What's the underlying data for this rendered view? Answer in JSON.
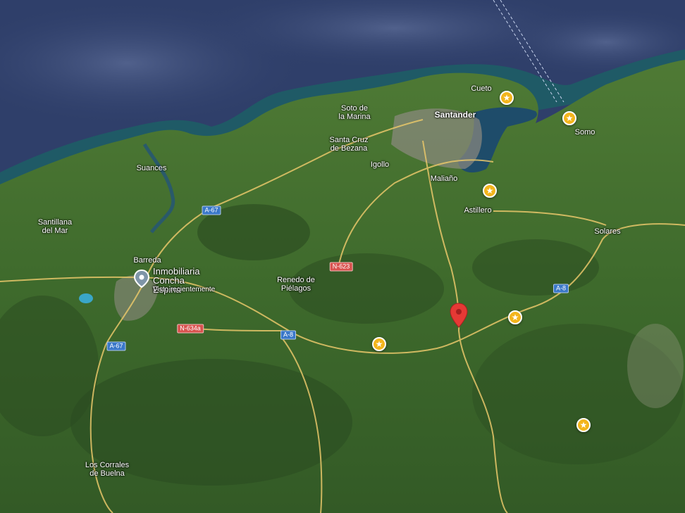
{
  "map": {
    "type": "satellite",
    "colors": {
      "sea": "#2f3f6a",
      "land": "#3d6a2c",
      "road": "#e8c76a",
      "marker_red": "#e53935",
      "poi": "#f3b51c"
    }
  },
  "towns": [
    {
      "id": "suances",
      "name": "Suances"
    },
    {
      "id": "santillana",
      "name": "Santillana\ndel Mar"
    },
    {
      "id": "soto",
      "name": "Soto de\nla Marina"
    },
    {
      "id": "santander",
      "name": "Santander"
    },
    {
      "id": "cueto",
      "name": "Cueto"
    },
    {
      "id": "somo",
      "name": "Somo"
    },
    {
      "id": "bezana",
      "name": "Santa Cruz\nde Bezana"
    },
    {
      "id": "igollo",
      "name": "Igollo"
    },
    {
      "id": "maliano",
      "name": "Maliaño"
    },
    {
      "id": "astillero",
      "name": "Astillero"
    },
    {
      "id": "solares",
      "name": "Solares"
    },
    {
      "id": "barreda",
      "name": "Barreda"
    },
    {
      "id": "renedo",
      "name": "Renedo de\nPiélagos"
    },
    {
      "id": "corrales",
      "name": "Los Corrales\nde Buelna"
    }
  ],
  "roads": [
    {
      "id": "a67n",
      "label": "A-67",
      "color": "blue"
    },
    {
      "id": "a67s",
      "label": "A-67",
      "color": "blue"
    },
    {
      "id": "a8w",
      "label": "A-8",
      "color": "blue"
    },
    {
      "id": "a8e",
      "label": "A-8",
      "color": "blue"
    },
    {
      "id": "n623",
      "label": "N-623",
      "color": "red"
    },
    {
      "id": "n634a",
      "label": "N-634a",
      "color": "red"
    }
  ],
  "saved_place": {
    "name": "Inmobiliaria\nConcha Espina",
    "subtitle": "Visto recientemente",
    "icon": "location-pin-icon"
  },
  "poi_markers": [
    {
      "id": "cueto",
      "icon": "star-icon",
      "glyph": "★"
    },
    {
      "id": "somo",
      "icon": "star-icon",
      "glyph": "★"
    },
    {
      "id": "astillero",
      "icon": "star-icon",
      "glyph": "★"
    },
    {
      "id": "a8",
      "icon": "star-icon",
      "glyph": "★"
    },
    {
      "id": "renedo",
      "icon": "star-icon",
      "glyph": "★"
    },
    {
      "id": "south",
      "icon": "star-icon",
      "glyph": "★"
    }
  ],
  "selected_marker": {
    "icon": "red-pin-icon"
  }
}
